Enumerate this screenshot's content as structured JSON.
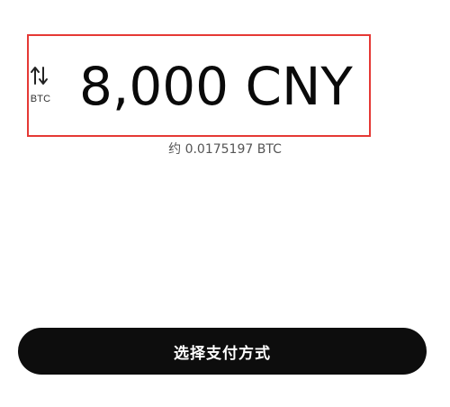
{
  "amount": {
    "value": "8,000 CNY",
    "highlight_color": "#e53935"
  },
  "currency_toggle": {
    "icon": "swap-vertical-arrows-icon",
    "label": "BTC"
  },
  "conversion_text": "约 0.0175197 BTC",
  "pay_button": {
    "label": "选择支付方式",
    "background": "#0d0d0d",
    "text_color": "#ffffff"
  }
}
